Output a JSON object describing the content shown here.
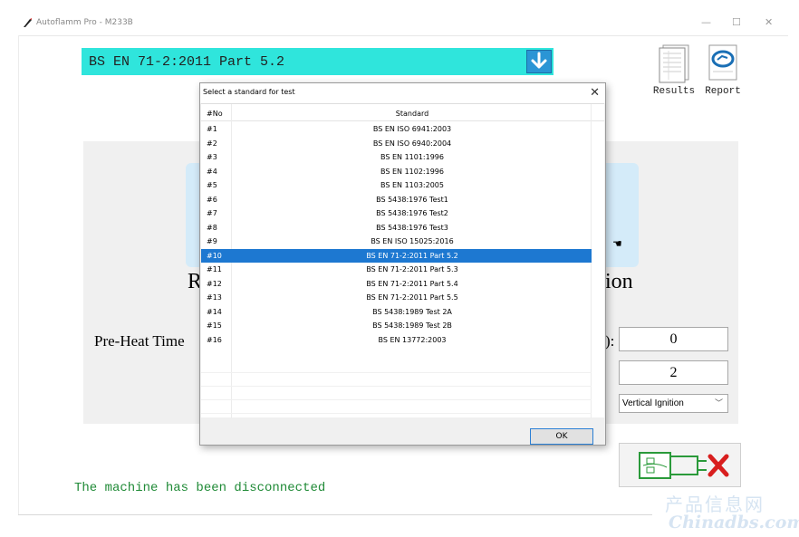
{
  "window": {
    "title": "Autoflamm Pro - M233B",
    "minimize": "—",
    "maximize": "☐",
    "close": "✕"
  },
  "standard_select": {
    "value": "BS EN 71-2:2011 Part 5.2"
  },
  "toolbar": {
    "results_label": "Results",
    "report_label": "Report"
  },
  "main": {
    "partial_left_text": "R",
    "partial_right_text": "ion",
    "preheat_label": "Pre-Heat Time",
    "colon_label": "):",
    "field_1_value": "0",
    "field_2_value": "2",
    "ignition_select": "Vertical Ignition"
  },
  "status": {
    "message": "The machine has been disconnected"
  },
  "dialog": {
    "title": "Select a standard for test",
    "close": "✕",
    "columns": [
      "#No",
      "Standard"
    ],
    "rows": [
      {
        "no": "#1",
        "standard": "BS EN ISO 6941:2003"
      },
      {
        "no": "#2",
        "standard": "BS EN ISO 6940:2004"
      },
      {
        "no": "#3",
        "standard": "BS EN 1101:1996"
      },
      {
        "no": "#4",
        "standard": "BS EN 1102:1996"
      },
      {
        "no": "#5",
        "standard": "BS EN 1103:2005"
      },
      {
        "no": "#6",
        "standard": "BS 5438:1976 Test1"
      },
      {
        "no": "#7",
        "standard": "BS 5438:1976 Test2"
      },
      {
        "no": "#8",
        "standard": "BS 5438:1976 Test3"
      },
      {
        "no": "#9",
        "standard": "BS EN ISO 15025:2016"
      },
      {
        "no": "#10",
        "standard": "BS EN 71-2:2011 Part 5.2",
        "selected": true
      },
      {
        "no": "#11",
        "standard": "BS EN 71-2:2011 Part 5.3"
      },
      {
        "no": "#12",
        "standard": "BS EN 71-2:2011 Part 5.4"
      },
      {
        "no": "#13",
        "standard": "BS EN 71-2:2011 Part 5.5"
      },
      {
        "no": "#14",
        "standard": "BS 5438:1989 Test 2A"
      },
      {
        "no": "#15",
        "standard": "BS 5438:1989 Test 2B"
      },
      {
        "no": "#16",
        "standard": "BS EN 13772:2003"
      }
    ],
    "ok_label": "OK"
  },
  "watermark": {
    "cn": "产品信息网",
    "en": "Chinadbs.com"
  },
  "colors": {
    "select_bg": "#2fe5dc",
    "selected_row": "#1d78d1",
    "status_text": "#1f8a36"
  }
}
